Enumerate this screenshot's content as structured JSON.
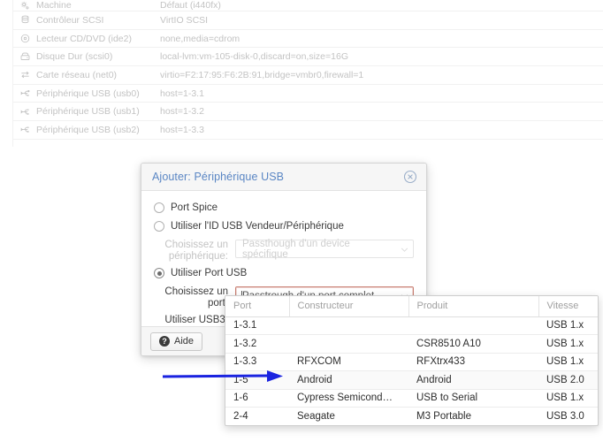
{
  "background_grid": {
    "rows": [
      {
        "icon": "machine-icon",
        "name": "Machine",
        "value": "Défaut (i440fx)"
      },
      {
        "icon": "scsi-icon",
        "name": "Contrôleur SCSI",
        "value": "VirtIO SCSI"
      },
      {
        "icon": "cdrom-icon",
        "name": "Lecteur CD/DVD (ide2)",
        "value": "none,media=cdrom"
      },
      {
        "icon": "harddisk-icon",
        "name": "Disque Dur (scsi0)",
        "value": "local-lvm:vm-105-disk-0,discard=on,size=16G"
      },
      {
        "icon": "network-icon",
        "name": "Carte réseau (net0)",
        "value": "virtio=F2:17:95:F6:2B:91,bridge=vmbr0,firewall=1"
      },
      {
        "icon": "usb-icon",
        "name": "Périphérique USB (usb0)",
        "value": "host=1-3.1"
      },
      {
        "icon": "usb-icon",
        "name": "Périphérique USB (usb1)",
        "value": "host=1-3.2"
      },
      {
        "icon": "usb-icon",
        "name": "Périphérique USB (usb2)",
        "value": "host=1-3.3"
      }
    ]
  },
  "dialog": {
    "title": "Ajouter: Périphérique USB",
    "close_icon": "close-circle-icon",
    "options": {
      "spice_label": "Port Spice",
      "spice_selected": false,
      "vendor_label": "Utiliser l'ID USB Vendeur/Périphérique",
      "vendor_selected": false,
      "usbport_label": "Utiliser Port USB",
      "usbport_selected": true
    },
    "device_field": {
      "label": "Choisissez un périphérique:",
      "value": "Passthough d'un device spécifique",
      "disabled": true
    },
    "port_field": {
      "label": "Choisissez un port:",
      "value": "Passtrough d'un port complet",
      "invalid": true
    },
    "usb3": {
      "label": "Utiliser USB3:",
      "checked": false
    },
    "footer": {
      "help_label": "Aide",
      "help_icon": "question-mark-icon"
    }
  },
  "picker": {
    "columns": [
      "Port",
      "Constructeur",
      "Produit",
      "Vitesse"
    ],
    "rows": [
      {
        "port": "1-3.1",
        "constructeur": "",
        "produit": "",
        "vitesse": "USB 1.x"
      },
      {
        "port": "1-3.2",
        "constructeur": "",
        "produit": "CSR8510 A10",
        "vitesse": "USB 1.x"
      },
      {
        "port": "1-3.3",
        "constructeur": "RFXCOM",
        "produit": "RFXtrx433",
        "vitesse": "USB 1.x"
      },
      {
        "port": "1-5",
        "constructeur": "Android",
        "produit": "Android",
        "vitesse": "USB 2.0"
      },
      {
        "port": "1-6",
        "constructeur": "Cypress Semicond…",
        "produit": "USB to Serial",
        "vitesse": "USB 1.x"
      },
      {
        "port": "2-4",
        "constructeur": "Seagate",
        "produit": "M3 Portable",
        "vitesse": "USB 3.0"
      }
    ]
  },
  "annotation": {
    "arrow_color": "#1a23e0",
    "arrow_name": "blue-pointer-arrow"
  },
  "colors": {
    "title_blue": "#5a86c4",
    "invalid_border": "#c97f72",
    "arrow_blue": "#1a23e0"
  }
}
